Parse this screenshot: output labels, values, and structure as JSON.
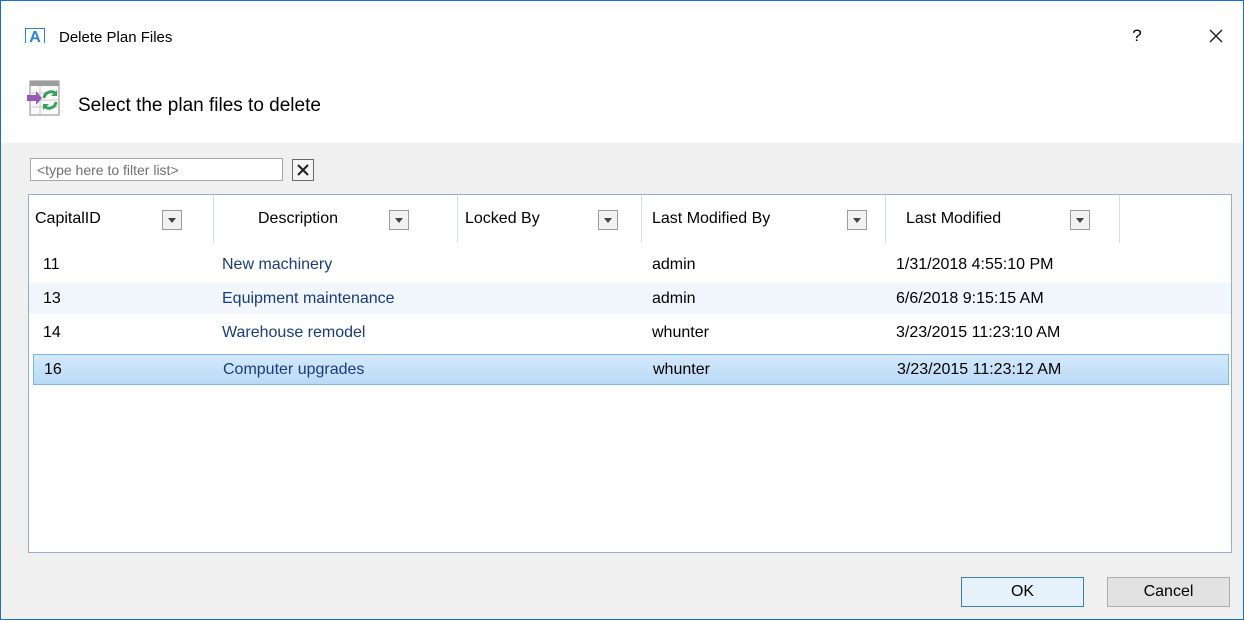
{
  "window": {
    "title": "Delete Plan Files",
    "app_icon_letter": "A",
    "help_label": "?"
  },
  "header": {
    "instruction": "Select the plan files to delete"
  },
  "filter": {
    "placeholder": "<type here to filter list>",
    "value": ""
  },
  "grid": {
    "columns": [
      {
        "label": "CapitalID"
      },
      {
        "label": "Description"
      },
      {
        "label": "Locked By"
      },
      {
        "label": "Last Modified By"
      },
      {
        "label": "Last Modified"
      }
    ],
    "rows": [
      {
        "id": "11",
        "description": "New machinery",
        "locked_by": "",
        "modified_by": "admin",
        "modified": "1/31/2018 4:55:10 PM"
      },
      {
        "id": "13",
        "description": "Equipment maintenance",
        "locked_by": "",
        "modified_by": "admin",
        "modified": "6/6/2018 9:15:15 AM"
      },
      {
        "id": "14",
        "description": "Warehouse remodel",
        "locked_by": "",
        "modified_by": "whunter",
        "modified": "3/23/2015 11:23:10 AM"
      },
      {
        "id": "16",
        "description": "Computer upgrades",
        "locked_by": "",
        "modified_by": "whunter",
        "modified": "3/23/2015 11:23:12 AM"
      }
    ],
    "selected_row": "16"
  },
  "buttons": {
    "ok": "OK",
    "cancel": "Cancel"
  },
  "colors": {
    "accent": "#1e6fc6",
    "selection": "#cce4f7",
    "alt_row": "#f1f6fd"
  }
}
